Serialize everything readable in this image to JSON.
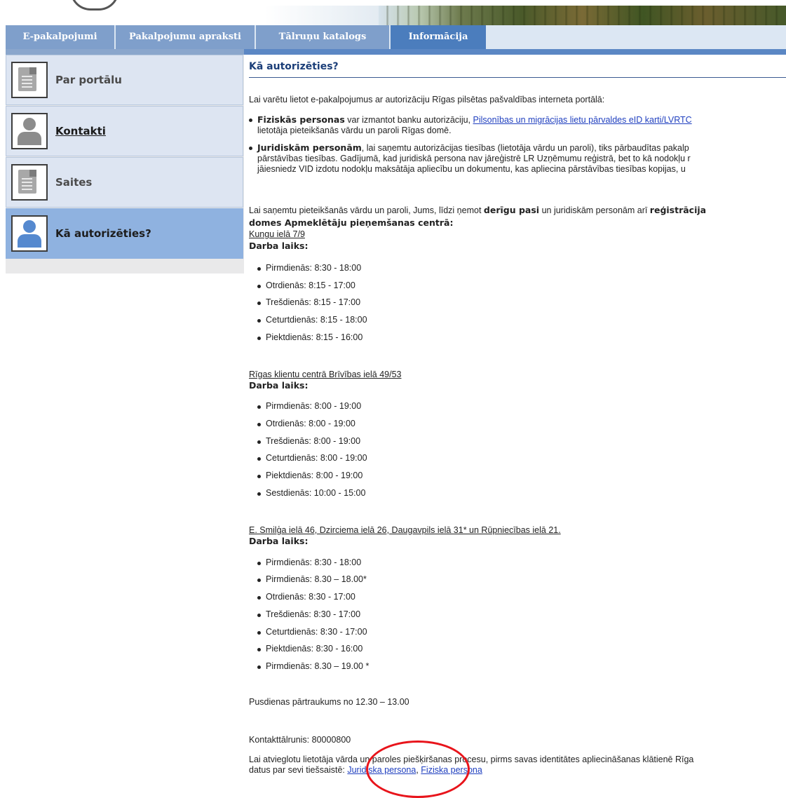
{
  "tabs": [
    {
      "label": "E-pakalpojumi"
    },
    {
      "label": "Pakalpojumu apraksti"
    },
    {
      "label": "Tālruņu katalogs"
    },
    {
      "label": "Informācija"
    }
  ],
  "sidebar": {
    "items": [
      {
        "label": "Par portālu",
        "icon": "document-icon"
      },
      {
        "label": "Kontakti",
        "icon": "person-icon"
      },
      {
        "label": "Saites",
        "icon": "document-icon"
      },
      {
        "label": "Kā autorizēties?",
        "icon": "person-icon"
      }
    ]
  },
  "main": {
    "title": "Kā autorizēties?",
    "intro": "Lai varētu lietot e-pakalpojumus ar autorizāciju Rīgas pilsētas pašvaldības interneta portālā:",
    "b1_bold": "Fiziskās personas",
    "b1_text": " var izmantot banku autorizāciju, ",
    "b1_link": "Pilsonības un migrācijas lietu pārvaldes eID karti/LVRTC",
    "b1_line2": "lietotāja pieteikšanās vārdu un paroli Rīgas domē.",
    "b2_bold": "Juridiskām personām",
    "b2_text": ", lai saņemtu autorizācijas tiesības (lietotāja vārdu un paroli), tiks pārbaudītas pakalp",
    "b2_line2": "pārstāvības tiesības. Gadījumā, kad juridiskā persona nav jāreģistrē LR Uzņēmumu reģistrā, bet to kā nodokļu r",
    "b2_line3": "jāiesniedz VID izdotu nodokļu maksātāja apliecību un dokumentu, kas apliecina pārstāvības tiesības kopijas, u",
    "p2_a": "Lai saņemtu pieteikšanās vārdu un paroli, Jums, līdzi ņemot ",
    "p2_b1": "derīgu pasi",
    "p2_c": " un juridiskām personām arī ",
    "p2_b2": "reģistrācija",
    "p2_line2": "domes Apmeklētāju pieņemšanas centrā:",
    "loc1": "Kungu ielā 7/9",
    "hours_label": "Darba laiks:",
    "loc1_hours": [
      "Pirmdienās: 8:30 - 18:00",
      "Otrdienās: 8:15 - 17:00",
      "Trešdienās: 8:15 - 17:00",
      "Ceturtdienās: 8:15 - 18:00",
      "Piektdienās: 8:15 - 16:00"
    ],
    "loc2": "Rīgas klientu centrā Brīvības ielā 49/53",
    "loc2_hours": [
      "Pirmdienās: 8:00 - 19:00",
      "Otrdienās: 8:00 - 19:00",
      "Trešdienās: 8:00 - 19:00",
      "Ceturtdienās: 8:00 - 19:00",
      "Piektdienās: 8:00 - 19:00",
      "Sestdienās: 10:00 - 15:00"
    ],
    "loc3": "E. Smilģa ielā 46, Dzirciema ielā 26, Daugavpils ielā 31* un Rūpniecības ielā 21.",
    "loc3_hours": [
      "Pirmdienās: 8:30 - 18:00",
      "Pirmdienās: 8.30 – 18.00*",
      "Otrdienās: 8:30 - 17:00",
      "Trešdienās: 8:30 - 17:00",
      "Ceturtdienās: 8:30 - 17:00",
      "Piektdienās: 8:30 - 16:00",
      "Pirmdienās: 8.30 – 19.00 *"
    ],
    "lunch": "Pusdienas pārtraukums no 12.30 – 13.00",
    "phone": "Kontakttālrunis: 80000800",
    "last_line1": "Lai atvieglotu lietotāja vārda un paroles piešķiršanas procesu, pirms savas identitātes apliecināšanas klātienē Rīga",
    "last_line2_text": "datus par sevi tiešsaistē: ",
    "link_juridiska": "Juridiska persona",
    "sep": ", ",
    "link_fiziska": "Fiziska persona"
  },
  "annotation_color": "#e8141b"
}
